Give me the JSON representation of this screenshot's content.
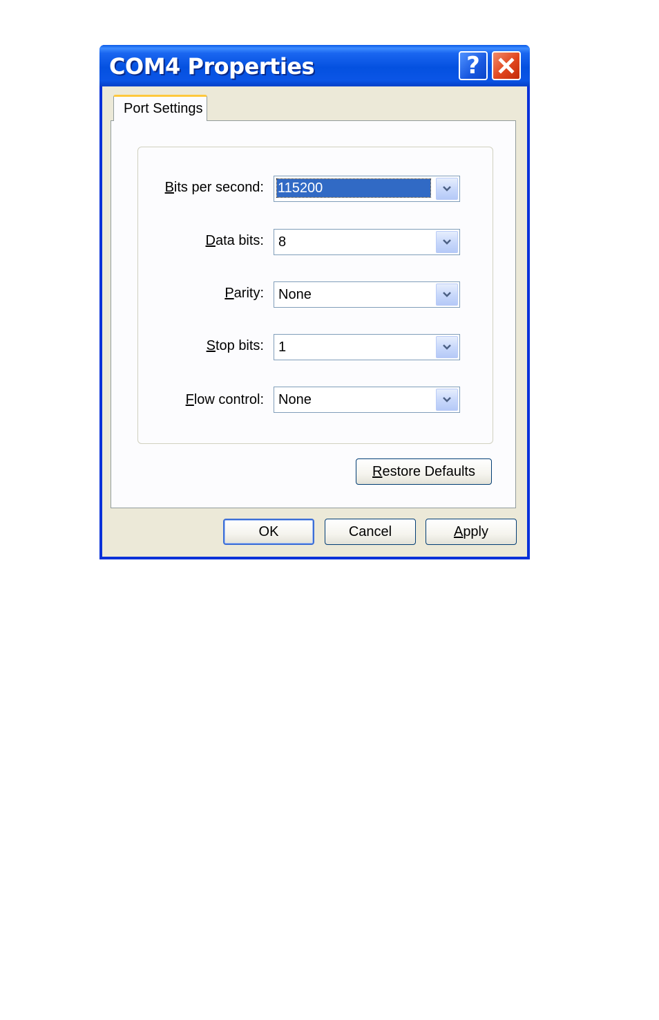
{
  "window": {
    "title": "COM4 Properties",
    "help_icon": "help-icon",
    "close_icon": "close-icon"
  },
  "tabs": [
    {
      "label": "Port Settings",
      "selected": true
    }
  ],
  "fields": {
    "bits_per_second": {
      "label_mnemonic": "B",
      "label_rest": "its per second:",
      "value": "115200"
    },
    "data_bits": {
      "label_mnemonic": "D",
      "label_rest": "ata bits:",
      "value": "8"
    },
    "parity": {
      "label_mnemonic": "P",
      "label_rest": "arity:",
      "value": "None"
    },
    "stop_bits": {
      "label_mnemonic": "S",
      "label_rest": "top bits:",
      "value": "1"
    },
    "flow_control": {
      "label_mnemonic": "F",
      "label_rest": "low control:",
      "value": "None"
    }
  },
  "buttons": {
    "restore_mnemonic": "R",
    "restore_rest": "estore Defaults",
    "ok": "OK",
    "cancel": "Cancel",
    "apply_mnemonic": "A",
    "apply_rest": "pply"
  },
  "colors": {
    "titlebar": "#0451e0",
    "selection": "#316ac5",
    "dialog_face": "#ece9d8"
  }
}
